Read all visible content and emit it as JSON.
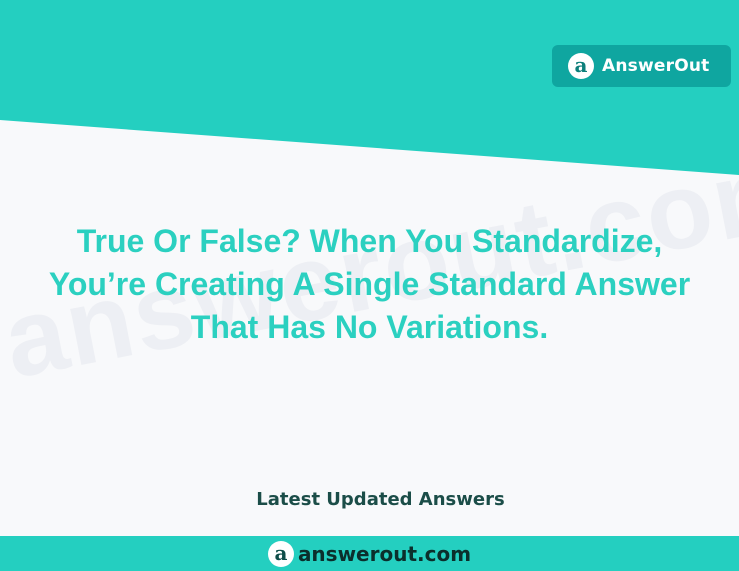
{
  "brand": {
    "logo_letter": "a",
    "name": "AnswerOut"
  },
  "watermark": "answerout.com",
  "question": {
    "lines": [
      "True Or False? When You Standardize,",
      "You’re Creating A Single Standard Answer",
      "That Has No Variations."
    ]
  },
  "section_heading": "Latest Updated Answers",
  "footer": {
    "logo_letter": "a",
    "site": "answerout.com"
  },
  "colors": {
    "teal_band": "#24cfc0",
    "badge": "#0fa6a0",
    "question_text": "#2bd0c0",
    "heading_text": "#1b4d48",
    "footer_text": "#0b2f2c",
    "background": "#f8f9fb"
  },
  "icons": {
    "logo": "answerout-a-icon"
  }
}
